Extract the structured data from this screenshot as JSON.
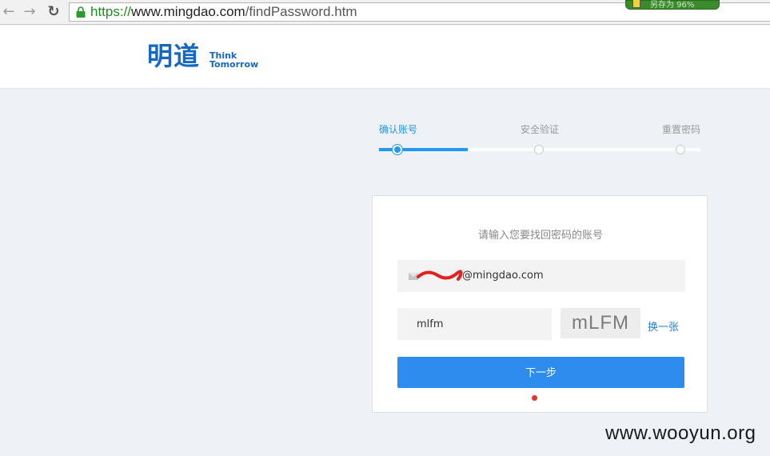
{
  "browser": {
    "back_icon": "←",
    "forward_icon": "→",
    "reload_icon": "↻",
    "url_scheme": "https://",
    "url_host": "www.mingdao.com",
    "url_path": "/findPassword.htm",
    "extension_label": "另存为 96%"
  },
  "header": {
    "logo_cn": "明道",
    "logo_en_line1": "Think",
    "logo_en_line2": "Tomorrow",
    "brand_color": "#1468c3"
  },
  "steps": {
    "items": [
      {
        "label": "确认账号",
        "active": true
      },
      {
        "label": "安全验证",
        "active": false
      },
      {
        "label": "重置密码",
        "active": false
      }
    ],
    "accent_color": "#2196f3"
  },
  "form": {
    "title": "请输入您要找回密码的账号",
    "account_value": "@mingdao.com",
    "captcha_input_value": "mlfm",
    "captcha_image_text": "mLFM",
    "refresh_label": "换一张",
    "next_label": "下一步",
    "button_color": "#2d8cee"
  },
  "watermark": "www.wooyun.org"
}
